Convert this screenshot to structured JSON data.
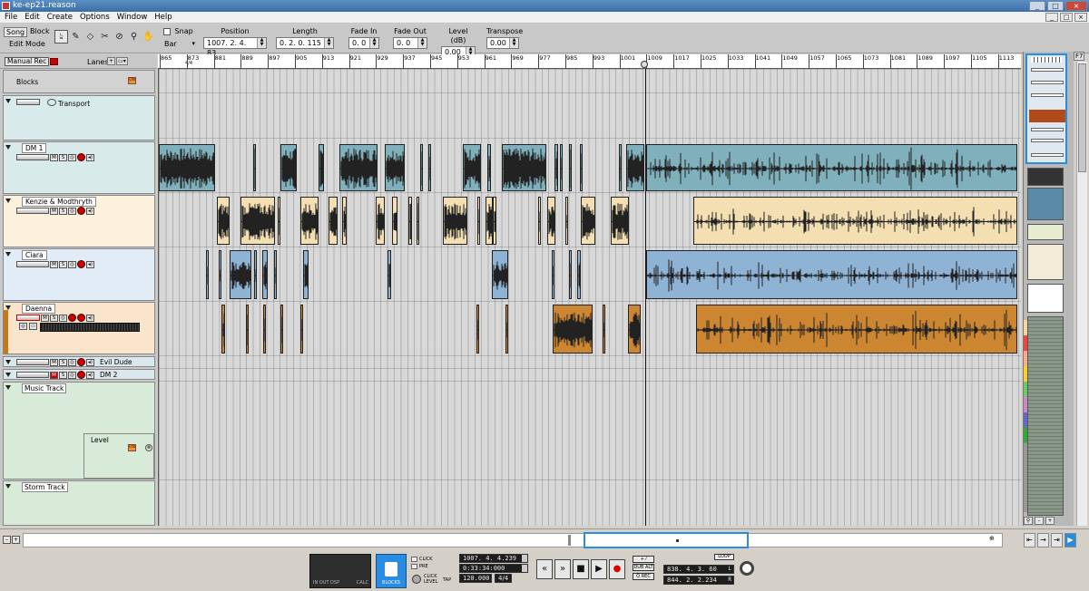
{
  "window": {
    "title": "ke-ep21.reason"
  },
  "menu": [
    "File",
    "Edit",
    "Create",
    "Options",
    "Window",
    "Help"
  ],
  "toolbar": {
    "song": "Song",
    "block": "Block",
    "edit_mode": "Edit Mode",
    "tools": [
      "arrow-icon",
      "pencil-icon",
      "eraser-icon",
      "razor-icon",
      "mute-icon",
      "magnify-icon",
      "hand-icon"
    ],
    "snap_label": "Snap",
    "snap_value": "Bar",
    "position_label": "Position",
    "position": "1007. 2. 4. 83",
    "length_label": "Length",
    "length": "0. 2. 0. 115",
    "fadein_label": "Fade In",
    "fadein": "0.   0",
    "fadeout_label": "Fade Out",
    "fadeout": "0.   0",
    "level_label": "Level (dB)",
    "level": "0.00",
    "transpose_label": "Transpose",
    "transpose": "0.00"
  },
  "sequencer": {
    "manual_rec": "Manual Rec",
    "lanes": "Lanes",
    "blocks": "Blocks",
    "transport": "Transport",
    "tracks": [
      "DM 1",
      "Kenzie & Modthryth",
      "Ciara",
      "Daenna",
      "Evil Dude",
      "DM 2",
      "Music Track",
      "Level",
      "Storm Track"
    ]
  },
  "ruler": {
    "bars": [
      "865",
      "873",
      "881",
      "889",
      "897",
      "905",
      "913",
      "921",
      "929",
      "937",
      "945",
      "953",
      "961",
      "969",
      "977",
      "985",
      "993",
      "1001",
      "1009",
      "1017",
      "1025",
      "1033",
      "1041",
      "1049",
      "1057",
      "1065",
      "1073",
      "1081",
      "1089",
      "1097",
      "1105",
      "1113"
    ],
    "signature": "4/4"
  },
  "side": {
    "f7": "F7"
  },
  "transport": {
    "in_out": "IN  OUT  DSP",
    "calc": "CALC",
    "blocks": "BLOCKS",
    "click": "CLICK",
    "pre": "PRE",
    "click_level": "CLICK LEVEL",
    "tap": "TAP",
    "position": "1007. 4. 4.239",
    "time": "0:33:34:000",
    "tempo": "120.000",
    "signature": "4/4",
    "dub": "DUB ALT",
    "qrec": "Q REC",
    "loop": "LOOP",
    "loop_left": "838. 4. 3. 60",
    "loop_right": "844. 2. 2.234",
    "l_label": "L",
    "r_label": "R"
  },
  "colors": {
    "dm1_clip": "#7fb0bb",
    "kenzie_clip": "#f3dfb2",
    "ciara_clip": "#8fb3d4",
    "daenna_clip": "#cc8632",
    "selection": "#2a8ce0"
  }
}
